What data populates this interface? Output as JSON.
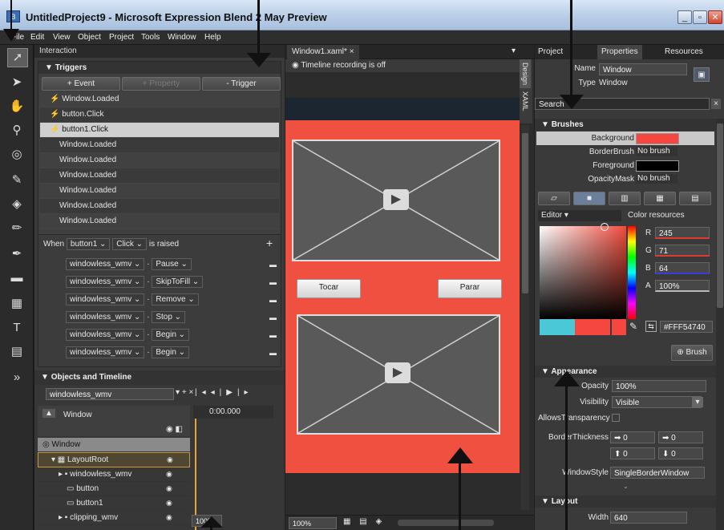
{
  "window": {
    "title": "UntitledProject9 - Microsoft Expression Blend 2 May Preview",
    "icon_label": "B"
  },
  "menu": [
    "File",
    "Edit",
    "View",
    "Object",
    "Project",
    "Tools",
    "Window",
    "Help"
  ],
  "interaction": {
    "title": "Interaction",
    "triggers_header": "Triggers",
    "buttons": {
      "event": "+ Event",
      "property": "+ Property",
      "trigger": "- Trigger"
    },
    "triggers": [
      "Window.Loaded",
      "button.Click",
      "button1.Click",
      "Window.Loaded",
      "Window.Loaded",
      "Window.Loaded",
      "Window.Loaded",
      "Window.Loaded",
      "Window.Loaded"
    ],
    "when_label": "When",
    "when_object": "button1",
    "when_event": "Click",
    "when_suffix": "is raised",
    "actions": [
      {
        "target": "windowless_wmv",
        "action": "Pause"
      },
      {
        "target": "windowless_wmv",
        "action": "SkipToFill"
      },
      {
        "target": "windowless_wmv",
        "action": "Remove"
      },
      {
        "target": "windowless_wmv",
        "action": "Stop"
      },
      {
        "target": "windowless_wmv",
        "action": "Begin"
      },
      {
        "target": "windowless_wmv",
        "action": "Begin"
      }
    ]
  },
  "objects": {
    "title": "Objects and Timeline",
    "selector": "windowless_wmv",
    "scope": "Window",
    "timecode": "0:00.000",
    "tree": [
      {
        "label": "Window",
        "indent": 0
      },
      {
        "label": "LayoutRoot",
        "indent": 1
      },
      {
        "label": "windowless_wmv",
        "indent": 2
      },
      {
        "label": "button",
        "indent": 3
      },
      {
        "label": "button1",
        "indent": 3
      },
      {
        "label": "clipping_wmv",
        "indent": 2
      }
    ],
    "zoom": "100%"
  },
  "document": {
    "tab": "Window1.xaml*",
    "recording": "Timeline recording is off",
    "side_tabs": [
      "Design",
      "XAML"
    ],
    "buttons": [
      "Tocar",
      "Parar"
    ],
    "zoom": "100%"
  },
  "properties": {
    "tabs": [
      "Project",
      "Properties",
      "Resources"
    ],
    "name_label": "Name",
    "name_value": "Window",
    "type_label": "Type",
    "type_value": "Window",
    "search": "Search",
    "brushes_header": "Brushes",
    "brushes": [
      {
        "label": "Background",
        "value": "",
        "swatch": "#f54740"
      },
      {
        "label": "BorderBrush",
        "value": "No brush"
      },
      {
        "label": "Foreground",
        "value": "",
        "swatch": "#000000"
      },
      {
        "label": "OpacityMask",
        "value": "No brush"
      }
    ],
    "editor_label": "Editor",
    "color_resources": "Color resources",
    "rgba": [
      {
        "label": "R",
        "value": "245"
      },
      {
        "label": "G",
        "value": "71"
      },
      {
        "label": "B",
        "value": "64"
      },
      {
        "label": "A",
        "value": "100%"
      }
    ],
    "hex": "#FFF54740",
    "brush_button": "Brush",
    "appearance_header": "Appearance",
    "opacity_label": "Opacity",
    "opacity_value": "100%",
    "visibility_label": "Visibility",
    "visibility_value": "Visible",
    "allows_transparency": "AllowsTransparency",
    "border_thickness": "BorderThickness",
    "thickness_values": [
      "0",
      "0",
      "0",
      "0"
    ],
    "windowstyle_label": "WindowStyle",
    "windowstyle_value": "SingleBorderWindow",
    "layout_header": "Layout",
    "width_label": "Width",
    "width_value": "640"
  },
  "colors": {
    "accent": "#f54740",
    "bg": "#3a3a3a",
    "selection": "#c9c9c9"
  }
}
